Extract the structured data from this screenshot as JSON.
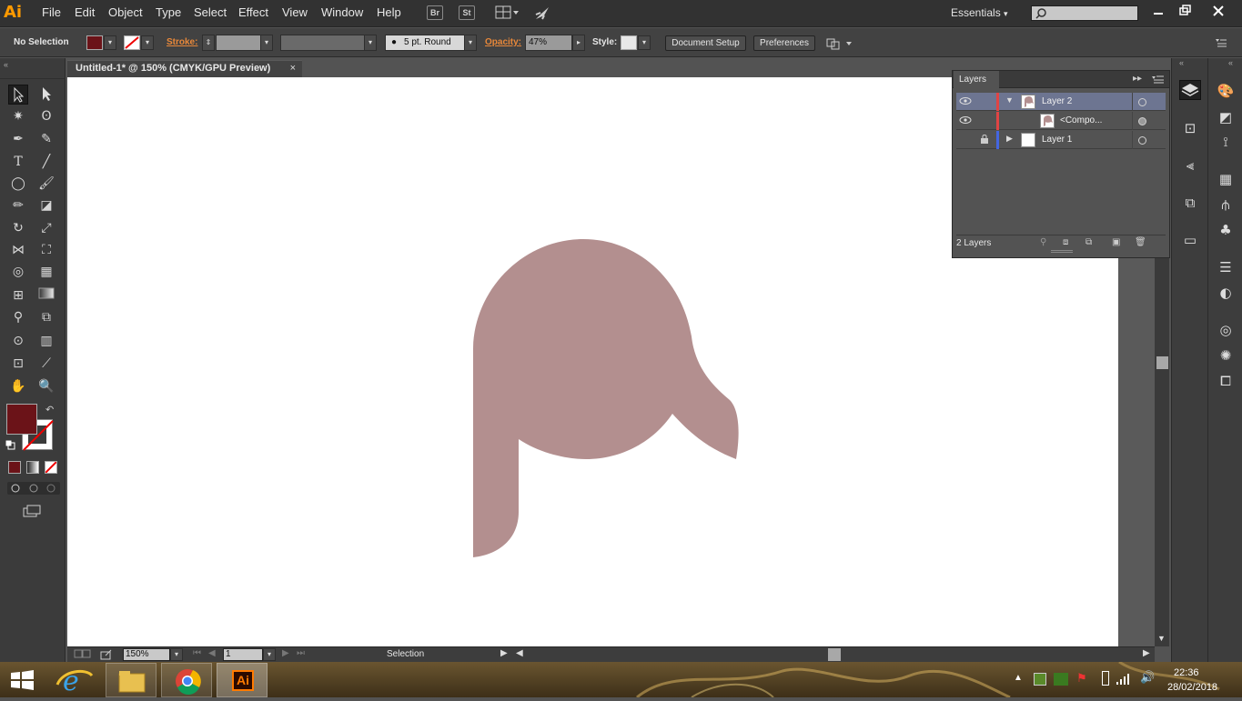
{
  "app": {
    "logo_text": "Ai",
    "menu": [
      "File",
      "Edit",
      "Object",
      "Type",
      "Select",
      "Effect",
      "View",
      "Window",
      "Help"
    ],
    "bridge_label": "Br",
    "stock_label": "St",
    "workspace": "Essentials",
    "workspace_arrow": "▾"
  },
  "control": {
    "selection_status": "No Selection",
    "stroke_label": "Stroke:",
    "brush_label": "5 pt. Round",
    "opacity_label": "Opacity:",
    "opacity_value": "47%",
    "style_label": "Style:",
    "document_setup": "Document Setup",
    "preferences": "Preferences",
    "fill_color": "#6b1318"
  },
  "document": {
    "tab_title": "Untitled-1* @ 150% (CMYK/GPU Preview)",
    "close": "×",
    "shape_color": "#b38f8f"
  },
  "status": {
    "zoom": "150%",
    "artboard": "1",
    "tool": "Selection"
  },
  "layers": {
    "title": "Layers",
    "rows": [
      {
        "name": "Layer 2",
        "color": "#e04444",
        "expanded": true,
        "selected": true
      },
      {
        "name": "<Compo...",
        "color": "#e04444",
        "expanded": false,
        "selected": false
      },
      {
        "name": "Layer 1",
        "color": "#4466e0",
        "expanded": false,
        "selected": false
      }
    ],
    "count": "2 Layers"
  },
  "colors": {
    "fill": "#6b1318"
  },
  "taskbar": {
    "time": "22:36",
    "date": "28/02/2018",
    "ai_label": "Ai"
  }
}
